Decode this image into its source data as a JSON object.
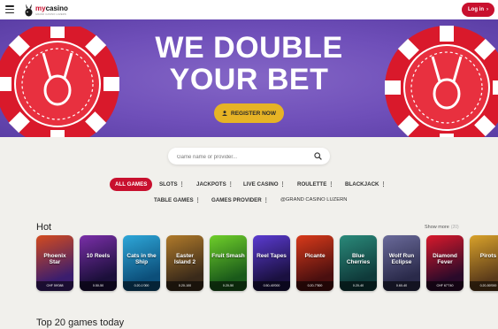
{
  "header": {
    "logo_text": "mycasino",
    "logo_prefix": "my",
    "logo_suffix": "casino",
    "logo_sub": "GRAND CASINO LUZERN",
    "login_label": "Log in",
    "login_icon": "chevron-right-icon"
  },
  "hero": {
    "title_line1": "WE DOUBLE",
    "title_line2": "YOUR BET",
    "register_label": "REGISTER NOW",
    "colors": {
      "background": "#6f4fb9",
      "chip_red": "#d9192b",
      "button": "#e6b325"
    }
  },
  "search": {
    "placeholder": "Game name or provider..."
  },
  "tabs": [
    {
      "label": "ALL GAMES",
      "active": true
    },
    {
      "label": "SLOTS",
      "kebab": "⋮"
    },
    {
      "label": "JACKPOTS",
      "kebab": "⋮"
    },
    {
      "label": "LIVE CASINO",
      "kebab": "⋮"
    },
    {
      "label": "ROULETTE",
      "kebab": "⋮"
    },
    {
      "label": "BLACKJACK",
      "kebab": "⋮"
    },
    {
      "label": "TABLE GAMES",
      "kebab": "⋮"
    },
    {
      "label": "GAMES PROVIDER",
      "kebab": "⋮"
    },
    {
      "label": "@GRAND CASINO LUZERN"
    }
  ],
  "hot": {
    "title": "Hot",
    "show_more": "Show more",
    "count": "(20)",
    "games": [
      {
        "title": "Phoenix Star",
        "bar": "CHF 59'088",
        "color1": "#3b1d6e",
        "color2": "#d44b1e"
      },
      {
        "title": "10 Reels",
        "bar": "0.50-50",
        "color1": "#1b0f3a",
        "color2": "#7a2fa8"
      },
      {
        "title": "Cats in the Ship",
        "bar": "0.20-1'000",
        "color1": "#0c4f7a",
        "color2": "#2ea7d9"
      },
      {
        "title": "Easter Island 2",
        "bar": "0.20-100",
        "color1": "#3a2a1a",
        "color2": "#b07a2a"
      },
      {
        "title": "Fruit Smash",
        "bar": "0.20-50",
        "color1": "#1a5a1a",
        "color2": "#6fcf2a"
      },
      {
        "title": "Reel Tapes",
        "bar": "0.50-40'000",
        "color1": "#1a1040",
        "color2": "#5b3bd1"
      },
      {
        "title": "Picante",
        "bar": "0.20-7'500",
        "color1": "#4a0f0f",
        "color2": "#d93a1a"
      },
      {
        "title": "Blue Cherries",
        "bar": "0.20-40",
        "color1": "#0f3a3a",
        "color2": "#2a8a7a"
      },
      {
        "title": "Wolf Run Eclipse",
        "bar": "0.60-40",
        "color1": "#2a2a4a",
        "color2": "#6a6a9a"
      },
      {
        "title": "Diamond Fever",
        "bar": "CHF 67'740",
        "color1": "#2a0a2a",
        "color2": "#d9192b"
      },
      {
        "title": "Pirots",
        "bar": "0.20-50'000",
        "color1": "#5a3a1a",
        "color2": "#d9a22a"
      }
    ]
  },
  "top20": {
    "title": "Top 20 games today"
  }
}
